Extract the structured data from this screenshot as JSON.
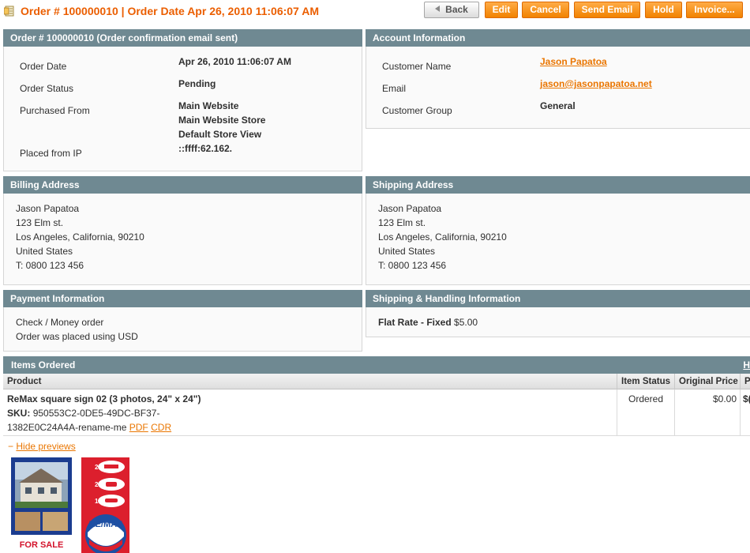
{
  "header": {
    "title": "Order # 100000010 | Order Date Apr 26, 2010 11:06:07 AM",
    "buttons": {
      "back": "Back",
      "edit": "Edit",
      "cancel": "Cancel",
      "send_email": "Send Email",
      "hold": "Hold",
      "invoice": "Invoice..."
    }
  },
  "order": {
    "heading": "Order # 100000010 (Order confirmation email sent)",
    "labels": {
      "date": "Order Date",
      "status": "Order Status",
      "from": "Purchased From",
      "ip": "Placed from IP"
    },
    "date": "Apr 26, 2010 11:06:07 AM",
    "status": "Pending",
    "purchased_from": [
      "Main Website",
      "Main Website Store",
      "Default Store View"
    ],
    "ip": "::ffff:62.162."
  },
  "account": {
    "heading": "Account Information",
    "labels": {
      "name": "Customer Name",
      "email": "Email",
      "group": "Customer Group"
    },
    "name": "Jason Papatoa",
    "email": "jason@jasonpapatoa.net",
    "group": "General"
  },
  "billing": {
    "heading": "Billing Address",
    "lines": [
      "Jason Papatoa",
      "123 Elm st.",
      "Los Angeles, California, 90210",
      "United States",
      "T: 0800 123 456"
    ]
  },
  "shipping": {
    "heading": "Shipping Address",
    "lines": [
      "Jason Papatoa",
      "123 Elm st.",
      "Los Angeles, California, 90210",
      "United States",
      "T: 0800 123 456"
    ]
  },
  "payment": {
    "heading": "Payment Information",
    "lines": [
      "Check / Money order",
      "Order was placed using USD"
    ]
  },
  "shipping_handling": {
    "heading": "Shipping & Handling Information",
    "method": "Flat Rate - Fixed",
    "price": "$5.00"
  },
  "items": {
    "heading": "Items Ordered",
    "header_link": "H",
    "columns": [
      "Product",
      "Item Status",
      "Original Price",
      "P"
    ],
    "rows": [
      {
        "name": "ReMax square sign 02 (3 photos, 24\" x 24\")",
        "sku_label": "SKU:",
        "sku_part1": "950553C2-0DE5-49DC-BF37-",
        "sku_part2": "1382E0C24A4A-rename-me",
        "pdf_link": "PDF",
        "cdr_link": "CDR",
        "status": "Ordered",
        "original_price": "$0.00",
        "price_partial": "$("
      }
    ],
    "hide_previews": "Hide previews",
    "hide_prefix": "−",
    "previews": {
      "sign1_text": "FOR SALE",
      "sign2_counts": [
        "2",
        "2",
        "1"
      ],
      "sign2_logo": "RE/MAX"
    }
  },
  "colors": {
    "accent": "#eb5e00",
    "button": "#f18200",
    "box_header": "#6f8992",
    "link": "#ea7601"
  }
}
